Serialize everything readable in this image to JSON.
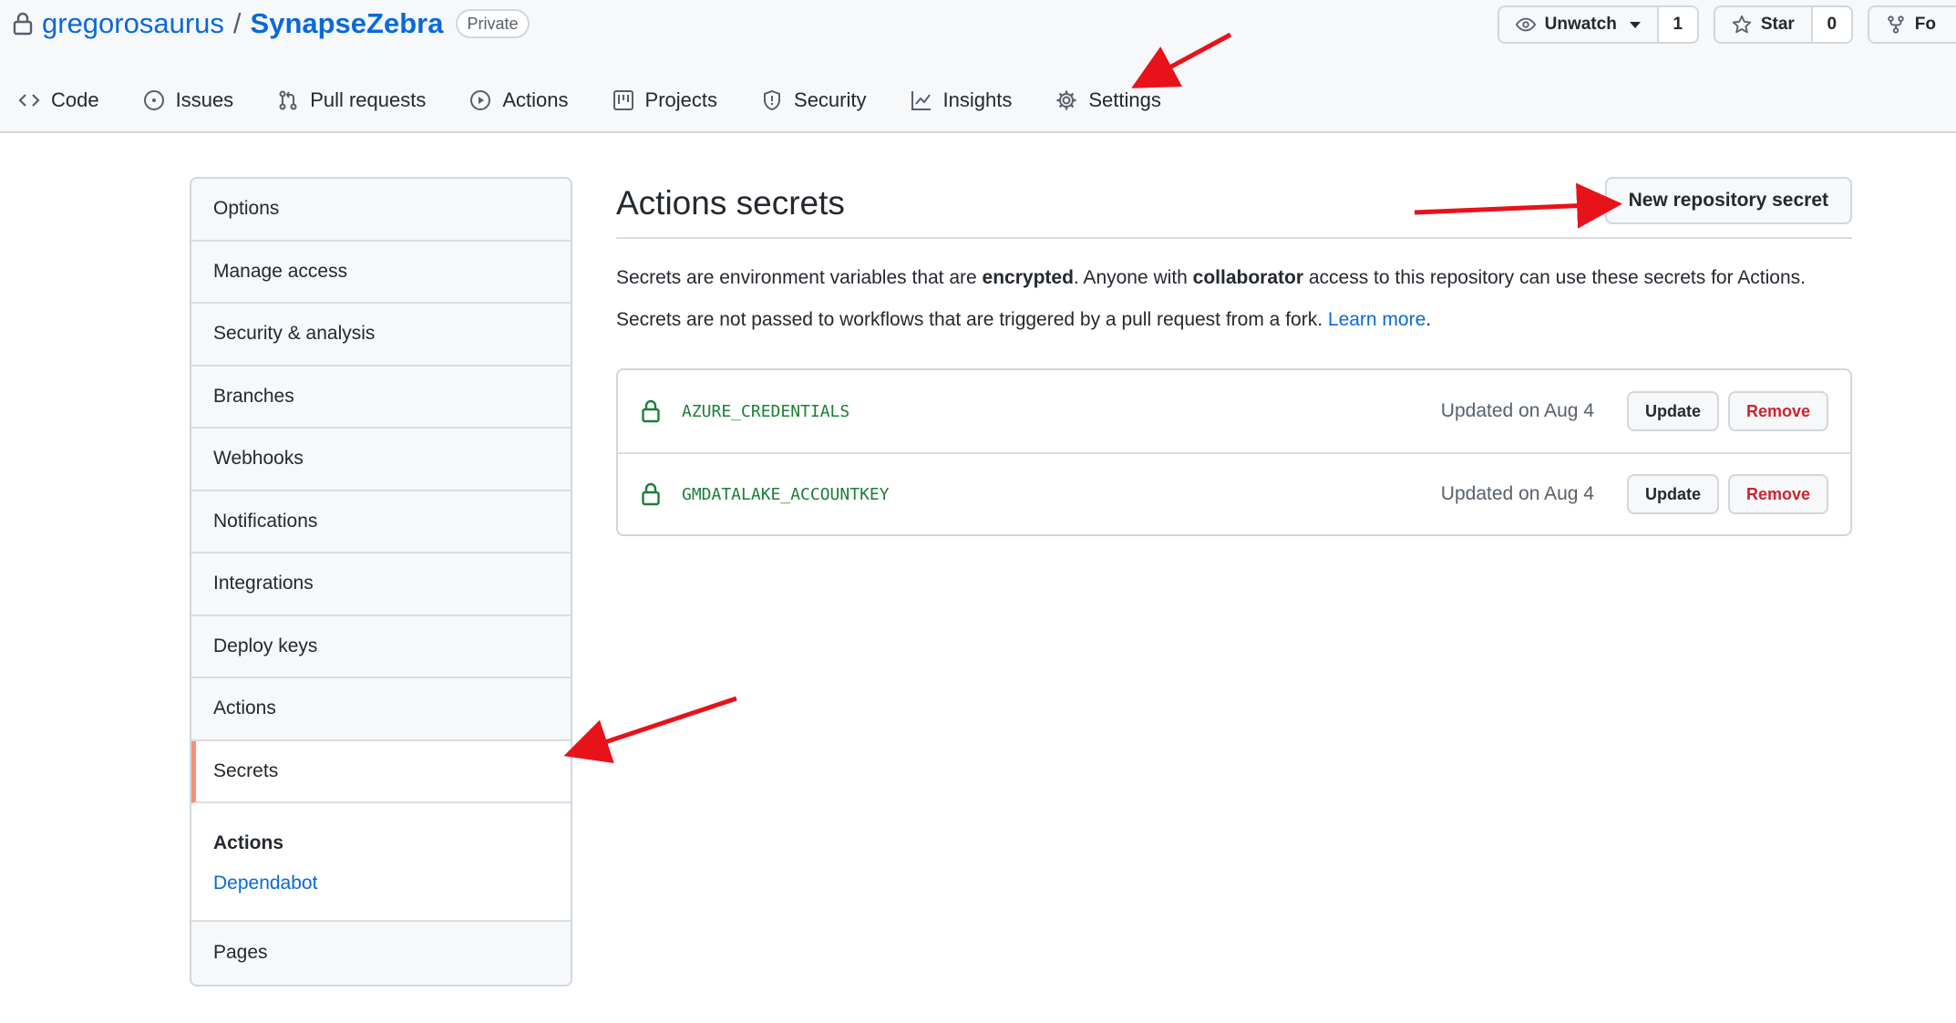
{
  "repo": {
    "owner": "gregorosaurus",
    "separator": "/",
    "name": "SynapseZebra",
    "visibility": "Private"
  },
  "header_actions": {
    "watch_label": "Unwatch",
    "watch_count": "1",
    "star_label": "Star",
    "star_count": "0",
    "fork_label_partial": "Fo"
  },
  "nav": [
    {
      "label": "Code",
      "icon": "code-icon"
    },
    {
      "label": "Issues",
      "icon": "issue-icon"
    },
    {
      "label": "Pull requests",
      "icon": "pull-request-icon"
    },
    {
      "label": "Actions",
      "icon": "play-icon"
    },
    {
      "label": "Projects",
      "icon": "project-icon"
    },
    {
      "label": "Security",
      "icon": "shield-icon"
    },
    {
      "label": "Insights",
      "icon": "graph-icon"
    },
    {
      "label": "Settings",
      "icon": "gear-icon"
    }
  ],
  "sidebar": {
    "items": [
      "Options",
      "Manage access",
      "Security & analysis",
      "Branches",
      "Webhooks",
      "Notifications",
      "Integrations",
      "Deploy keys",
      "Actions",
      "Secrets"
    ],
    "selected": "Secrets",
    "subsection": {
      "title": "Actions",
      "link": "Dependabot"
    },
    "last_item": "Pages"
  },
  "main": {
    "title": "Actions secrets",
    "new_button": "New repository secret",
    "desc1": {
      "p1": "Secrets are environment variables that are ",
      "b1": "encrypted",
      "p2": ". Anyone with ",
      "b2": "collaborator",
      "p3": " access to this repository can use these secrets for Actions."
    },
    "desc2": {
      "text": "Secrets are not passed to workflows that are triggered by a pull request from a fork. ",
      "link": "Learn more",
      "end": "."
    },
    "secrets": [
      {
        "name": "AZURE_CREDENTIALS",
        "updated": "Updated on Aug 4",
        "update_label": "Update",
        "remove_label": "Remove"
      },
      {
        "name": "GMDATALAKE_ACCOUNTKEY",
        "updated": "Updated on Aug 4",
        "update_label": "Update",
        "remove_label": "Remove"
      }
    ]
  },
  "colors": {
    "accent": "#0969da",
    "secret_name": "#1a7f37",
    "danger": "#cf222e",
    "selected_marker": "#fd8c73",
    "annotation_arrow": "#e8121a"
  }
}
